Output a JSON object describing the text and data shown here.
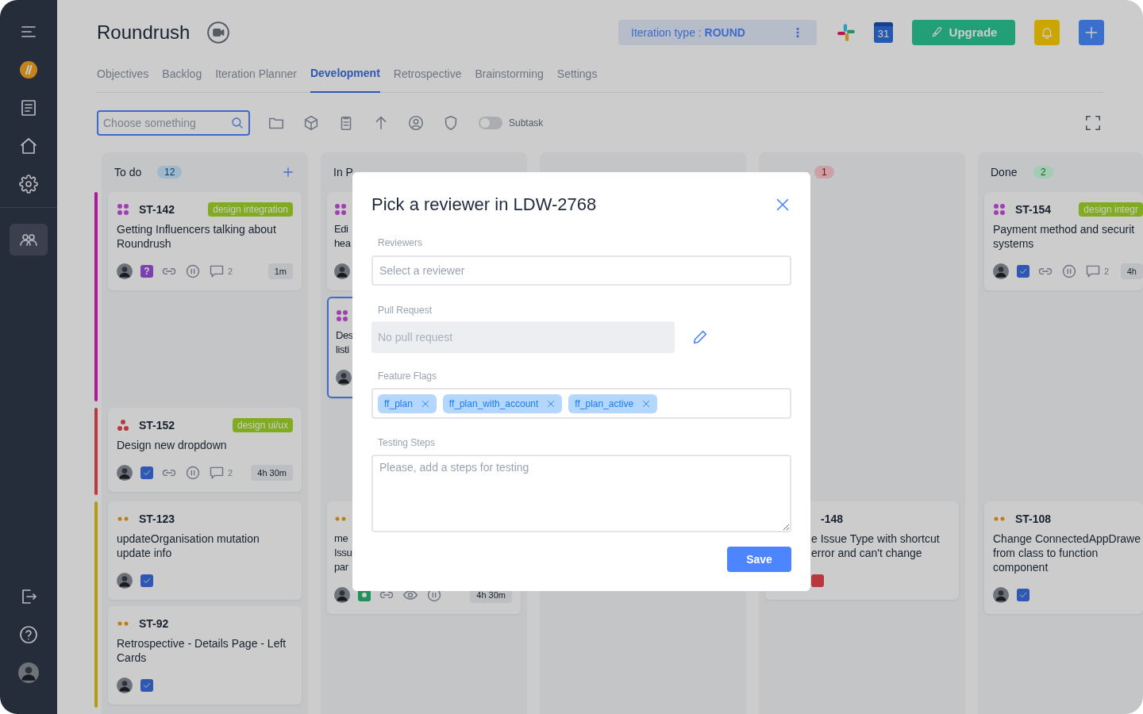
{
  "sidebar": {
    "top": [
      {
        "kind": "menu",
        "selected": false
      },
      {
        "kind": "logo",
        "selected": false
      },
      {
        "kind": "document",
        "selected": false
      },
      {
        "kind": "home",
        "selected": false
      },
      {
        "kind": "settings",
        "selected": false
      }
    ],
    "middle": [
      {
        "kind": "team",
        "selected": true
      }
    ],
    "bottom": [
      {
        "kind": "logout",
        "selected": false
      },
      {
        "kind": "help",
        "selected": false
      },
      {
        "kind": "avatar",
        "selected": false
      }
    ]
  },
  "header": {
    "title": "Roundrush",
    "iteration": "Iteration type : **ROUND**",
    "calendar_day": "31",
    "upgrade": "Upgrade"
  },
  "tabs": [
    {
      "label": "Objectives",
      "selected": false
    },
    {
      "label": "Backlog",
      "selected": false
    },
    {
      "label": "Iteration Planner",
      "selected": false
    },
    {
      "label": "Development",
      "selected": true
    },
    {
      "label": "Retrospective",
      "selected": false
    },
    {
      "label": "Brainstorming",
      "selected": false
    },
    {
      "label": "Settings",
      "selected": false
    }
  ],
  "toolbar": {
    "search": {
      "placeholder": "Choose something"
    },
    "icons": [
      {
        "kind": "folder"
      },
      {
        "kind": "cube"
      },
      {
        "kind": "clipboard"
      },
      {
        "kind": "arrow-up"
      },
      {
        "kind": "user-circle"
      },
      {
        "kind": "shield"
      }
    ],
    "subtask_toggle": {
      "label": "Subtask",
      "on": false
    }
  },
  "columns": [
    {
      "title": "To do",
      "count": "12",
      "color": "#9fb8cc",
      "addable": true
    },
    {
      "title": "In P"
    },
    {},
    {
      "count": "1",
      "color": "#d8a1a4"
    },
    {
      "title": "Done",
      "count": "2",
      "color": "#a3cdb3"
    }
  ],
  "lanes": [
    {
      "color": "#ad1999",
      "cells": [
        [
          {
            "priority": {
              "kind": "highest"
            },
            "id": "ST-142",
            "tag": "design integration",
            "title": "Getting Influencers talking about Roundrush",
            "status": {
              "kind": "question",
              "symbol": "?"
            },
            "icons": [
              {
                "kind": "link"
              },
              {
                "kind": "pause"
              },
              {
                "kind": "comment"
              }
            ],
            "comments": "2",
            "time": "1m"
          }
        ],
        [
          {
            "priority": {
              "kind": "highest"
            },
            "lines": [
              "Edi",
              "hea"
            ]
          },
          {
            "priority": {
              "kind": "highest"
            },
            "lines": [
              "Des",
              "listi"
            ],
            "selected": true
          }
        ],
        [],
        [],
        [
          {
            "priority": {
              "kind": "highest"
            },
            "id": "ST-154",
            "tag": "design integr",
            "lines": [
              "Payment method and securit",
              "systems"
            ],
            "status": {
              "kind": "done"
            },
            "icons": [
              {
                "kind": "link"
              },
              {
                "kind": "pause"
              },
              {
                "kind": "comment"
              }
            ],
            "comments": "2",
            "time": "4h"
          }
        ]
      ]
    },
    {
      "color": "#b73a3e",
      "cells": [
        [
          {
            "priority": {
              "kind": "high"
            },
            "id": "ST-152",
            "tag": "design ui/ux",
            "title": "Design new dropdown",
            "status": {
              "kind": "done"
            },
            "icons": [
              {
                "kind": "link"
              },
              {
                "kind": "pause"
              },
              {
                "kind": "comment"
              }
            ],
            "comments": "2",
            "time": "4h 30m"
          }
        ],
        [],
        [],
        [],
        []
      ]
    },
    {
      "color": "#b39b15",
      "cells": [
        [
          {
            "priority": {
              "kind": "medium"
            },
            "id": "ST-123",
            "title": "updateOrganisation mutation update info",
            "status": {
              "kind": "done"
            }
          },
          {
            "priority": {
              "kind": "medium"
            },
            "id": "ST-92",
            "title": "Retrospective - Details Page - Left Cards",
            "status": {
              "kind": "done"
            }
          }
        ],
        [
          {
            "priority": {
              "kind": "medium"
            },
            "lines": [
              "me",
              "Issu",
              "par"
            ],
            "status": {
              "kind": "active"
            },
            "icons": [
              {
                "kind": "link"
              },
              {
                "kind": "eye"
              },
              {
                "kind": "pause"
              }
            ],
            "time": "4h 30m"
          }
        ],
        [],
        [
          {
            "id": "-148",
            "lines": [
              "e Issue Type with shortcut",
              "error and can't change"
            ],
            "status": {
              "kind": "blocked"
            },
            "offset": true
          }
        ],
        [
          {
            "priority": {
              "kind": "medium"
            },
            "id": "ST-108",
            "lines": [
              "Change ConnectedAppDrawe",
              "from class to function",
              "component"
            ],
            "status": {
              "kind": "done"
            }
          }
        ]
      ]
    }
  ],
  "modal": {
    "title": "Pick a reviewer in LDW-2768",
    "reviewers": {
      "label": "Reviewers",
      "placeholder": "Select a reviewer"
    },
    "pull_request": {
      "label": "Pull Request",
      "placeholder": "No pull request",
      "disabled": true
    },
    "feature_flags": {
      "label": "Feature Flags",
      "chips": [
        "ff_plan",
        "ff_plan_with_account",
        "ff_plan_active"
      ]
    },
    "testing_steps": {
      "label": "Testing Steps",
      "placeholder": "Please, add a steps for testing"
    },
    "save": "Save"
  }
}
